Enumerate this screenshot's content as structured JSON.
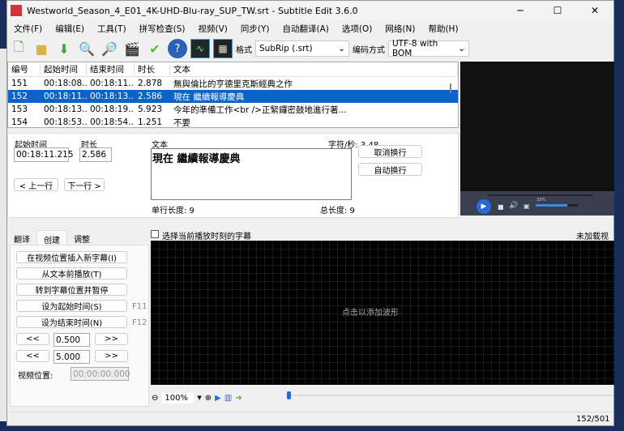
{
  "window": {
    "title": "Westworld_Season_4_E01_4K-UHD-Blu-ray_SUP_TW.srt - Subtitle Edit 3.6.0",
    "icon_text": "SE"
  },
  "menu": [
    "文件(F)",
    "编辑(E)",
    "工具(T)",
    "拼写检查(S)",
    "视频(V)",
    "同步(Y)",
    "自动翻译(A)",
    "选项(O)",
    "网络(N)",
    "帮助(H)"
  ],
  "toolbar": {
    "format_label": "格式",
    "format_value": "SubRip (.srt)",
    "encoding_label": "编码方式",
    "encoding_value": "UTF-8 with BOM"
  },
  "list": {
    "headers": [
      "编号",
      "起始时间",
      "结束时间",
      "时长",
      "文本"
    ],
    "rows": [
      [
        "151",
        "00:18:08....",
        "00:18:11....",
        "2.878",
        "無與倫比的亨德里克斯經典之作"
      ],
      [
        "152",
        "00:18:11....",
        "00:18:13....",
        "2.586",
        "現在 繼續報導慶典"
      ],
      [
        "153",
        "00:18:13....",
        "00:18:19....",
        "5.923",
        "今年的準備工作<br />正緊鑼密鼓地進行著..."
      ],
      [
        "154",
        "00:18:53....",
        "00:18:54....",
        "1.251",
        "不要"
      ]
    ]
  },
  "edit": {
    "start_label": "起始时间",
    "start_value": "00:18:11.215",
    "duration_label": "时长",
    "duration_value": "2.586",
    "text_label": "文本",
    "cps": "字符/秒: 3.48",
    "text": "現在 繼續報導慶典",
    "line_length": "单行长度: 9",
    "total_length": "总长度: 9",
    "prev": "< 上一行",
    "next": "下一行 >",
    "unbreak": "取消换行",
    "autobreak": "自动换行"
  },
  "video": {
    "volume": "33%"
  },
  "tabs": [
    "翻译",
    "创建",
    "调整"
  ],
  "create": {
    "insert": "在视频位置插入新字幕(I)",
    "play_before": "从文本前播放(T)",
    "goto_pause": "转到字幕位置并暂停",
    "set_start": "设为起始时间(S)",
    "set_end": "设为结束时间(N)",
    "f11": "F11",
    "f12": "F12",
    "back": "<<",
    "fwd": ">>",
    "step1": "0.500",
    "step2": "5.000",
    "video_pos_label": "视频位置:",
    "video_pos": "00:00:00.000"
  },
  "waveform": {
    "checkbox": "选择当前播放时刻的字幕",
    "no_video": "未加载视频",
    "placeholder": "点击以添加波形",
    "zoom": "100%"
  },
  "status": {
    "position": "152/501"
  }
}
